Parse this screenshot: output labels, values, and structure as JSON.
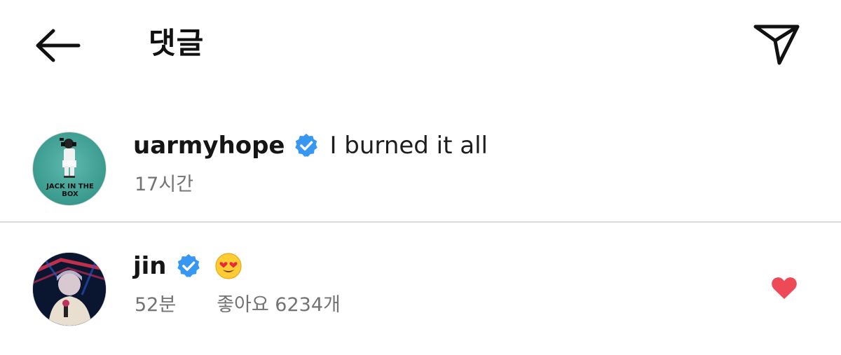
{
  "header": {
    "title": "댓글",
    "back_icon": "arrow-left-icon",
    "share_icon": "paper-plane-icon"
  },
  "comments": [
    {
      "username": "uarmyhope",
      "verified": true,
      "text": "I burned it all",
      "time": "17시간",
      "avatar_text": "JACK IN THE BOX"
    },
    {
      "username": "jin",
      "verified": true,
      "emoji": "heart-eyes-emoji",
      "time": "52분",
      "likes": "좋아요 6234개",
      "liked": true
    }
  ],
  "colors": {
    "verified_blue": "#3897f0",
    "liked_red": "#ed4956",
    "meta_gray": "#737373",
    "divider": "#dcdcdc"
  }
}
